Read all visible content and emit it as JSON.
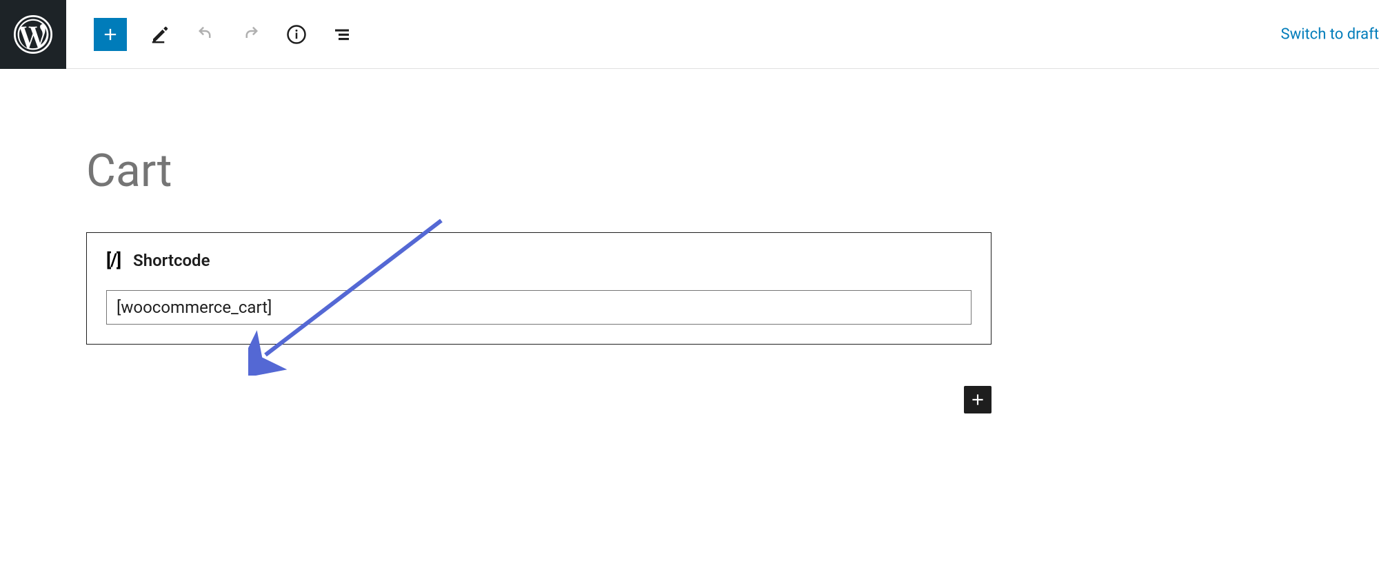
{
  "toolbar": {
    "switch_draft_label": "Switch to draft"
  },
  "page": {
    "title": "Cart"
  },
  "shortcode_block": {
    "label": "Shortcode",
    "value": "[woocommerce_cart]"
  }
}
